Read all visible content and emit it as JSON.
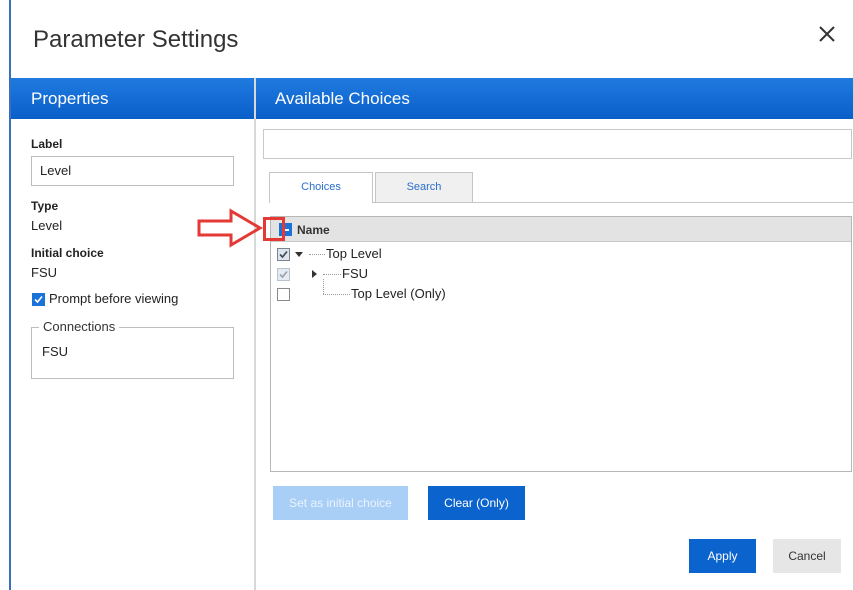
{
  "dialog": {
    "title": "Parameter Settings"
  },
  "panels": {
    "properties_header": "Properties",
    "choices_header": "Available Choices"
  },
  "properties": {
    "label_title": "Label",
    "label_value": "Level",
    "type_title": "Type",
    "type_value": "Level",
    "initial_choice_title": "Initial choice",
    "initial_choice_value": "FSU",
    "prompt_label": "Prompt before viewing",
    "prompt_checked": true,
    "connections_legend": "Connections",
    "connections": [
      "FSU"
    ]
  },
  "search": {
    "value": "",
    "placeholder": ""
  },
  "tabs": [
    {
      "label": "Choices",
      "active": true
    },
    {
      "label": "Search",
      "active": false
    }
  ],
  "grid": {
    "column_name": "Name",
    "rows": [
      {
        "label": "Top Level",
        "check_state": "checked",
        "expander": "expanded"
      },
      {
        "label": "FSU",
        "check_state": "checked-disabled",
        "expander": "collapsed"
      },
      {
        "label": "Top Level (Only)",
        "check_state": "unchecked",
        "expander": "none"
      }
    ]
  },
  "buttons": {
    "set_initial": "Set as initial choice",
    "clear_only": "Clear (Only)",
    "apply": "Apply",
    "cancel": "Cancel"
  },
  "colors": {
    "accent": "#0b63ce",
    "annotation": "#e53935"
  },
  "icons": {
    "close": "close-icon",
    "search": "search-icon",
    "arrow": "arrow-right-icon"
  }
}
